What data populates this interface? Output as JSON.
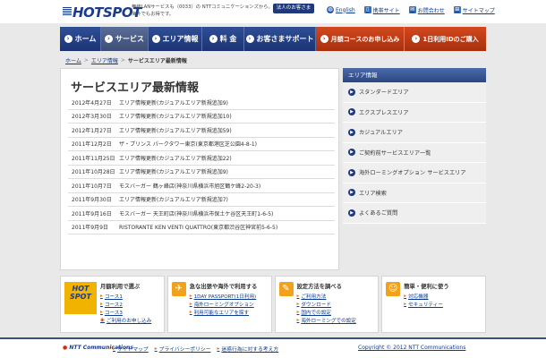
{
  "header": {
    "logo": "HOTSPOT",
    "tagline": "無線LANサービスも（0033）の NTTコミュニケーションズから。海外でもお得です。",
    "corporate_button": "法人のお客さま",
    "links": [
      {
        "label": "English",
        "icon": "globe-icon"
      },
      {
        "label": "携帯サイト",
        "icon": "mobile-icon"
      },
      {
        "label": "お問合わせ",
        "icon": "mail-icon"
      },
      {
        "label": "サイトマップ",
        "icon": "sitemap-icon"
      }
    ]
  },
  "nav": {
    "items": [
      {
        "label": "ホーム",
        "active": false
      },
      {
        "label": "サービス",
        "active": true
      },
      {
        "label": "エリア情報",
        "active": false
      },
      {
        "label": "料 金",
        "active": false
      },
      {
        "label": "お客さまサポート",
        "active": false
      },
      {
        "label": "月額コースのお申し込み",
        "orange": true
      },
      {
        "label": "1日利用IDのご購入",
        "orange": true
      }
    ]
  },
  "breadcrumb": {
    "items": [
      "ホーム",
      "エリア情報",
      "サービスエリア最新情報"
    ]
  },
  "main": {
    "title": "サービスエリア最新情報",
    "news": [
      {
        "date": "2012年4月27日",
        "text": "エリア情報更新(カジュアルエリア新規追加9)"
      },
      {
        "date": "2012年3月30日",
        "text": "エリア情報更新(カジュアルエリア新規追加10)"
      },
      {
        "date": "2012年1月27日",
        "text": "エリア情報更新(カジュアルエリア新規追加59)"
      },
      {
        "date": "2011年12月2日",
        "text": "ザ・プリンス パークタワー東京(東京都港区芝公園4-8-1)"
      },
      {
        "date": "2011年11月25日",
        "text": "エリア情報更新(カジュアルエリア新規追加22)"
      },
      {
        "date": "2011年10月28日",
        "text": "エリア情報更新(カジュアルエリア新規追加9)"
      },
      {
        "date": "2011年10月7日",
        "text": "モスバーガー 鶴ヶ峰店(神奈川県横浜市旭区鶴ケ峰2-20-3)"
      },
      {
        "date": "2011年9月30日",
        "text": "エリア情報更新(カジュアルエリア新規追加7)"
      },
      {
        "date": "2011年9月16日",
        "text": "モスバーガー 天王町店(神奈川県横浜市保土ケ谷区天王町1-6-5)"
      },
      {
        "date": "2011年9月9日",
        "text": "RISTORANTE KEN VENTI QUATTRO(東京都渋谷区神宮前5-6-5)"
      }
    ]
  },
  "sidebar": {
    "title": "エリア情報",
    "items": [
      "スタンダードエリア",
      "エクスプレスエリア",
      "カジュアルエリア",
      "ご契約前サービスエリア一覧",
      "海外ローミングオプション サービスエリア",
      "エリア検索",
      "よくあるご質問"
    ]
  },
  "bottom": {
    "box1": {
      "title": "月額利用で選ぶ",
      "badge": "HOT SPOT",
      "links": [
        "コース1",
        "コース2",
        "コース3",
        "ご利用のお申し込み"
      ]
    },
    "box2": {
      "title": "急な出張や海外で利用する",
      "links": [
        "1DAY PASSPORT(1日利用)",
        "海外ローミングオプション",
        "利用可能なエリアを探す"
      ]
    },
    "box3": {
      "title": "設定方法を調べる",
      "links": [
        "ご利用方法",
        "ダウンロード",
        "国内での設定",
        "海外ローミングでの設定"
      ]
    },
    "box4": {
      "title": "簡単・便利に使う",
      "links": [
        "対応機器",
        "セキュリティー"
      ]
    }
  },
  "footer": {
    "brand": "NTT Communications",
    "links": [
      "サイトマップ",
      "プライバシーポリシー",
      "迷惑行為に対する考え方"
    ],
    "copyright": "Copyright © 2012 NTT Communications"
  }
}
